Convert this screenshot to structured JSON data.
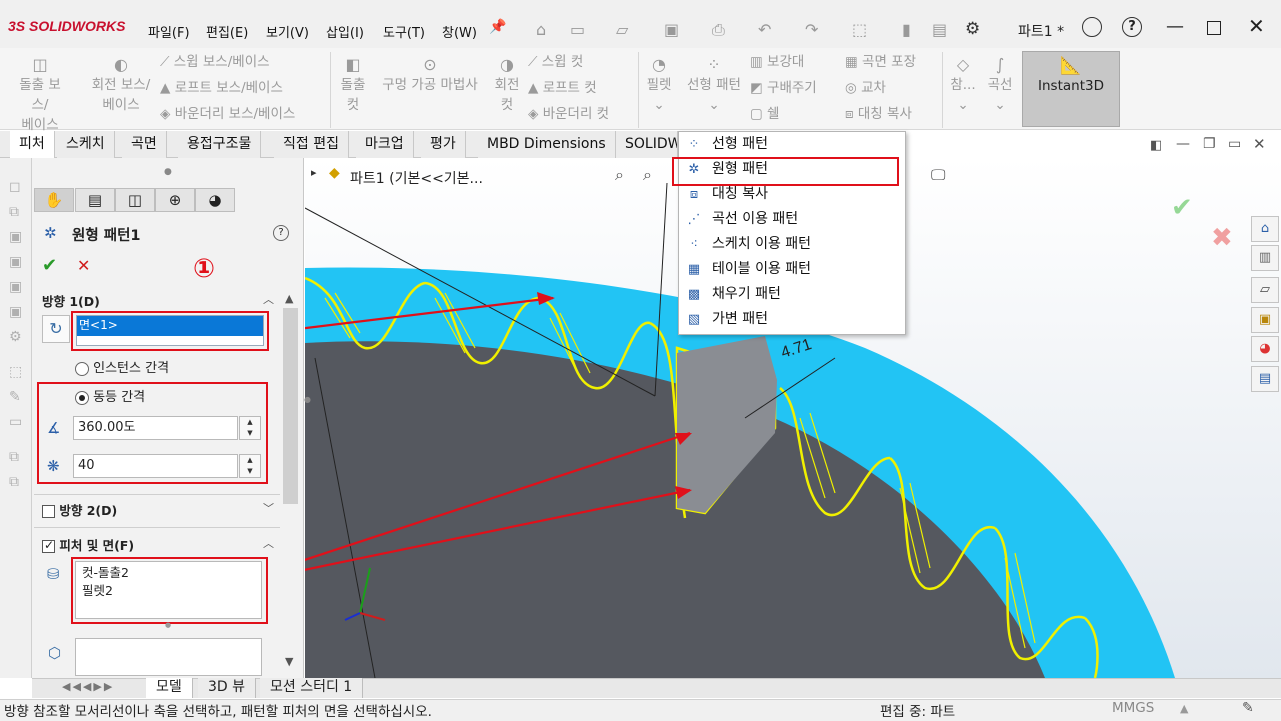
{
  "app": {
    "logo": "3S SOLIDWORKS",
    "document_title": "파트1 *"
  },
  "menu": [
    "파일(F)",
    "편집(E)",
    "보기(V)",
    "삽입(I)",
    "도구(T)",
    "창(W)"
  ],
  "ribbon": {
    "col1": [
      "돌출 보스/",
      "베이스"
    ],
    "col2": [
      "회전 보스/",
      "베이스"
    ],
    "col3": [
      "스윕 보스/베이스",
      "로프트 보스/베이스",
      "바운더리 보스/베이스"
    ],
    "col4": [
      "돌출",
      "컷"
    ],
    "col5": "구멍 가공 마법사",
    "col6": [
      "회전",
      "컷"
    ],
    "col7": [
      "스윕 컷",
      "로프트 컷",
      "바운더리 컷"
    ],
    "col8": "필렛",
    "col9": "선형 패턴",
    "col10": [
      "보강대",
      "구배주기",
      "쉘"
    ],
    "col11": [
      "곡면 포장",
      "교차",
      "대칭 복사"
    ],
    "col12": "참...",
    "col13": "곡선",
    "instant3d": "Instant3D"
  },
  "tabs": [
    "피처",
    "스케치",
    "곡면",
    "용접구조물",
    "직접 편집",
    "마크업",
    "평가",
    "MBD Dimensions",
    "SOLIDW"
  ],
  "property_manager": {
    "title": "원형 패턴1",
    "annotation_number": "①",
    "direction1": {
      "title": "방향 1(D)",
      "reference": "면<1>",
      "option_instance": "인스턴스 간격",
      "option_equal": "동등 간격",
      "angle": "360.00도",
      "count": "40"
    },
    "direction2": {
      "title": "방향 2(D)"
    },
    "features_faces": {
      "title": "피처 및 면(F)",
      "items": [
        "컷-돌출2",
        "필렛2"
      ]
    }
  },
  "viewport": {
    "breadcrumb": "파트1  (기본<<기본...",
    "dimension": "4.71"
  },
  "dropdown": {
    "items": [
      {
        "label": "선형 패턴",
        "icon": "linear-pattern-icon"
      },
      {
        "label": "원형 패턴",
        "icon": "circular-pattern-icon"
      },
      {
        "label": "대칭 복사",
        "icon": "mirror-icon"
      },
      {
        "label": "곡선 이용 패턴",
        "icon": "curve-pattern-icon"
      },
      {
        "label": "스케치 이용 패턴",
        "icon": "sketch-pattern-icon"
      },
      {
        "label": "테이블 이용 패턴",
        "icon": "table-pattern-icon"
      },
      {
        "label": "채우기 패턴",
        "icon": "fill-pattern-icon"
      },
      {
        "label": "가변 패턴",
        "icon": "variable-pattern-icon"
      }
    ]
  },
  "bottom_tabs": [
    "모델",
    "3D 뷰",
    "모션 스터디 1"
  ],
  "status": {
    "message": "방향 참조할 모서리선이나 축을 선택하고, 패턴할 피처의 면을 선택하십시오.",
    "mode": "편집 중: 파트",
    "units": "MMGS"
  },
  "colors": {
    "accent_red": "#e0101a",
    "face_blue": "#22c4f4",
    "body_grey": "#55585f",
    "highlight_yellow": "#f0f000"
  }
}
